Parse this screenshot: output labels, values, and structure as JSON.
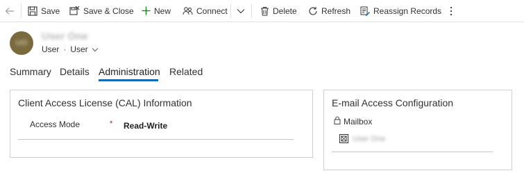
{
  "toolbar": {
    "save_label": "Save",
    "save_close_label": "Save & Close",
    "new_label": "New",
    "connect_label": "Connect",
    "delete_label": "Delete",
    "refresh_label": "Refresh",
    "reassign_label": "Reassign Records"
  },
  "header": {
    "avatar_initials": "UO",
    "record_name": "User One",
    "entity_type": "User",
    "form_name": "User"
  },
  "tabs": [
    {
      "label": "Summary"
    },
    {
      "label": "Details"
    },
    {
      "label": "Administration"
    },
    {
      "label": "Related"
    }
  ],
  "cal_section": {
    "title": "Client Access License (CAL) Information",
    "access_mode_label": "Access Mode",
    "required_marker": "*",
    "access_mode_value": "Read-Write"
  },
  "email_section": {
    "title": "E-mail Access Configuration",
    "mailbox_label": "Mailbox",
    "mailbox_value": "User One"
  },
  "colors": {
    "accent": "#0f6cbd",
    "required": "#a4262c",
    "border": "#d2d0ce"
  }
}
